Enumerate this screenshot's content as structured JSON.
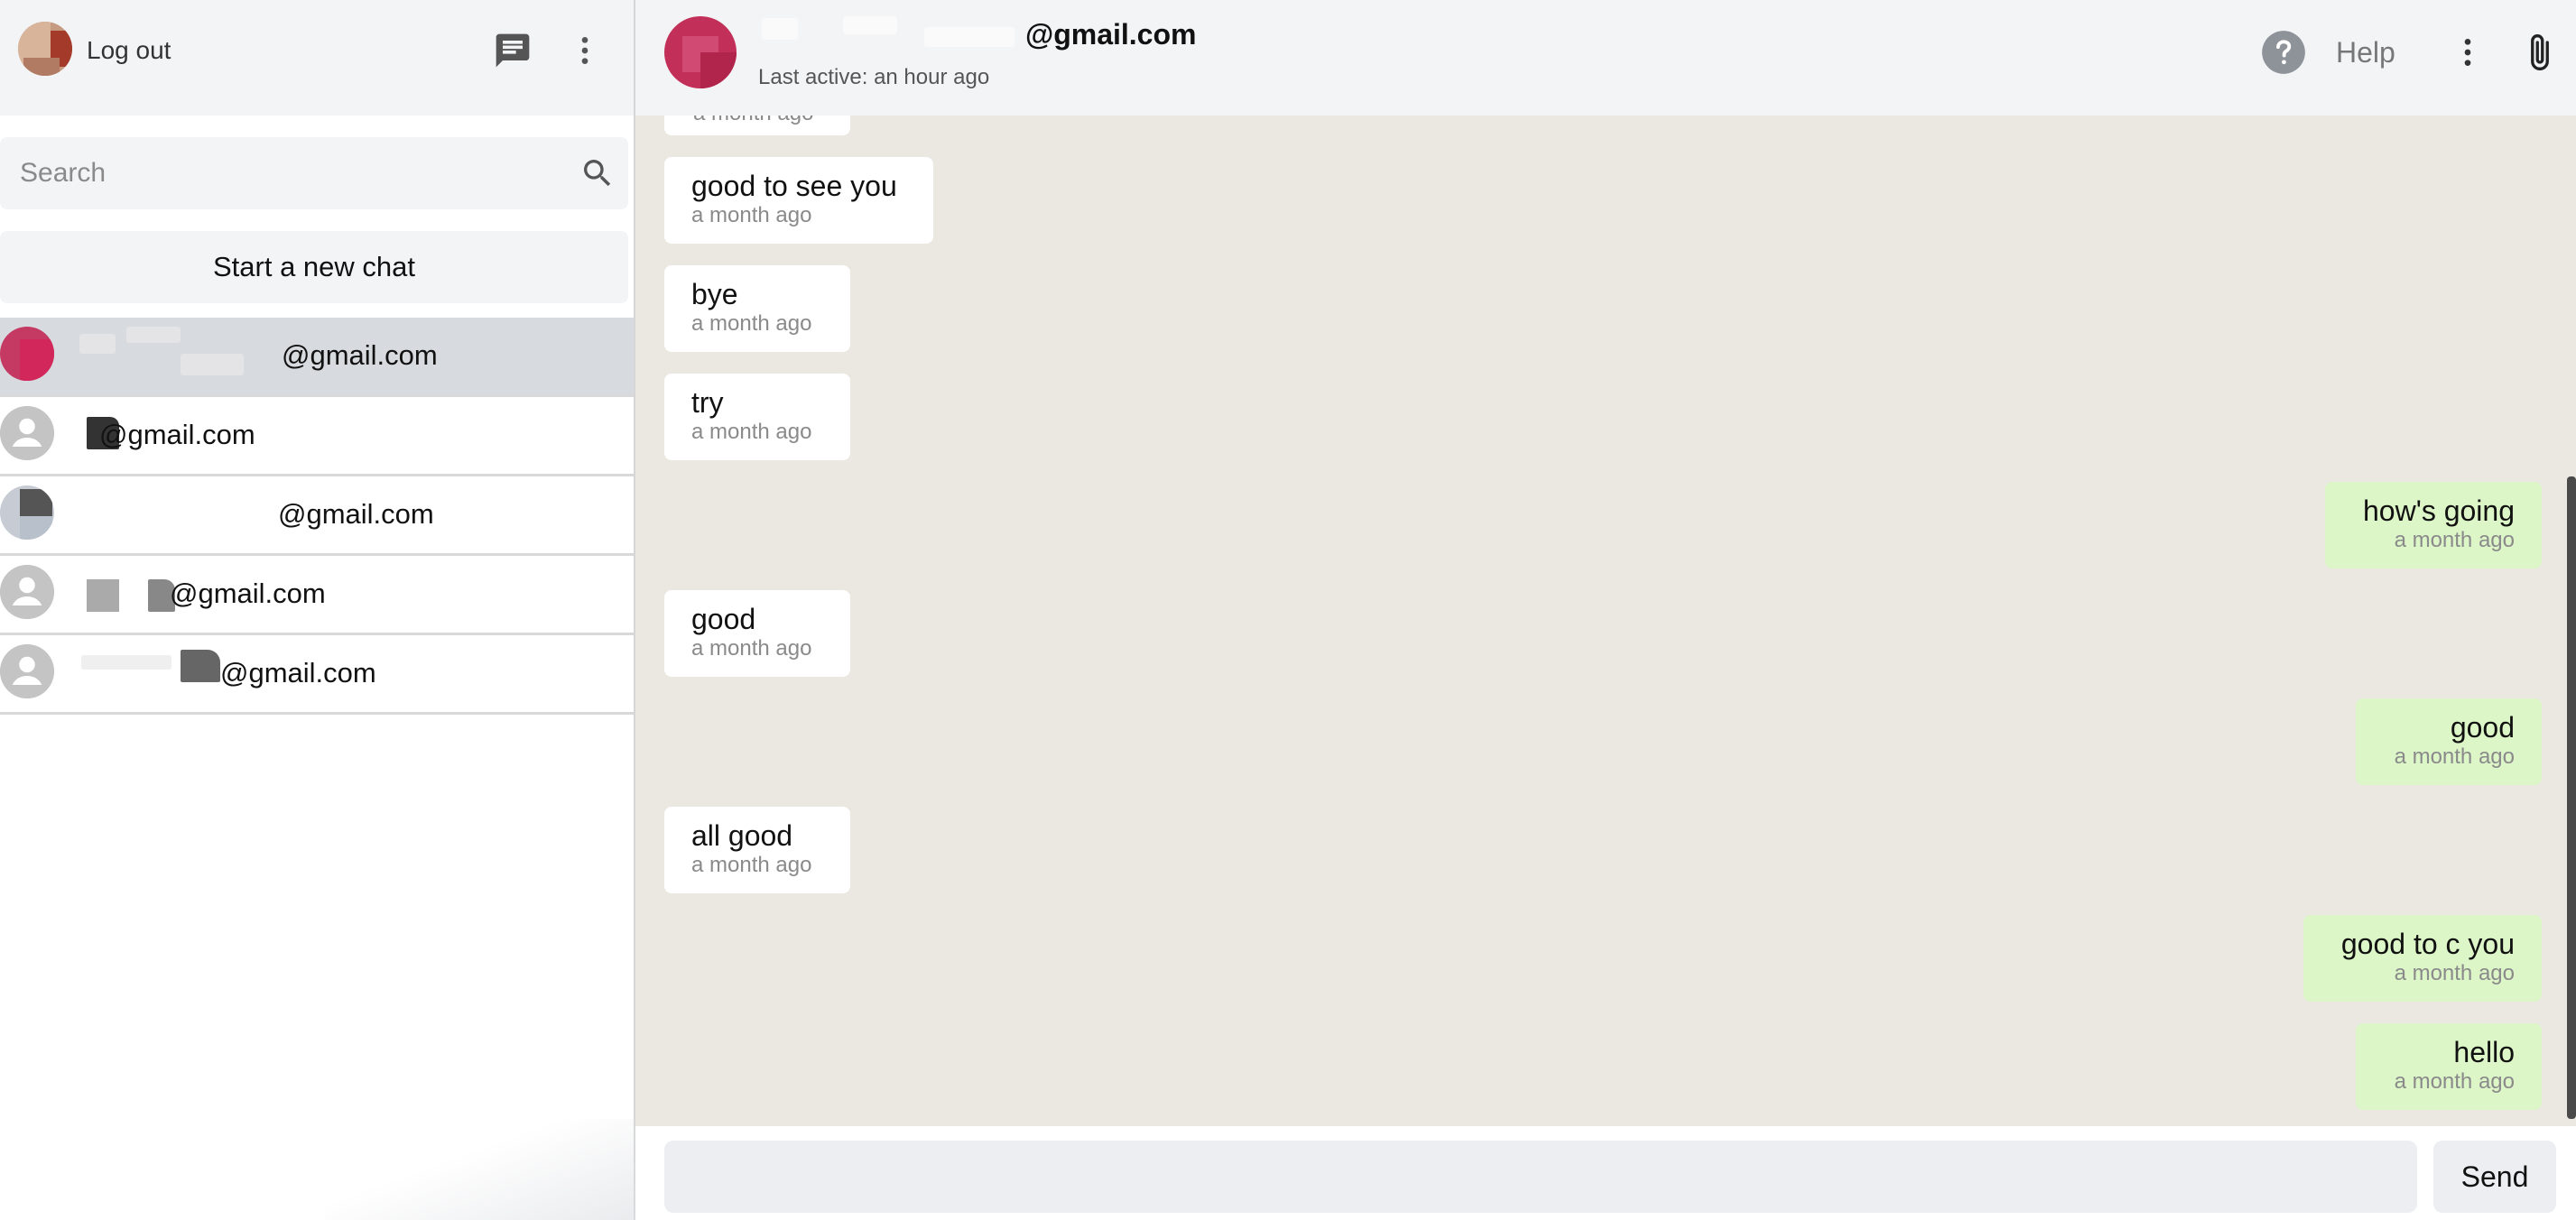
{
  "sidebar": {
    "logout_label": "Log out",
    "search_placeholder": "Search",
    "new_chat_label": "Start a new chat",
    "contacts": [
      {
        "name": "@gmail.com",
        "active": true
      },
      {
        "name": "@gmail.com",
        "active": false
      },
      {
        "name": "@gmail.com",
        "active": false
      },
      {
        "name": "@gmail.com",
        "active": false
      },
      {
        "name": "@gmail.com",
        "active": false
      }
    ]
  },
  "chat": {
    "peer_name": "@gmail.com",
    "last_active": "Last active: an hour ago",
    "help_label": "Help",
    "messages": [
      {
        "text": "",
        "time": "a month ago",
        "direction": "in"
      },
      {
        "text": "good to see you",
        "time": "a month ago",
        "direction": "in"
      },
      {
        "text": "bye",
        "time": "a month ago",
        "direction": "in"
      },
      {
        "text": "try",
        "time": "a month ago",
        "direction": "in"
      },
      {
        "text": "how's going",
        "time": "a month ago",
        "direction": "out"
      },
      {
        "text": "good",
        "time": "a month ago",
        "direction": "in"
      },
      {
        "text": "good",
        "time": "a month ago",
        "direction": "out"
      },
      {
        "text": "all good",
        "time": "a month ago",
        "direction": "in"
      },
      {
        "text": "good to c you",
        "time": "a month ago",
        "direction": "out"
      },
      {
        "text": "hello",
        "time": "a month ago",
        "direction": "out"
      }
    ],
    "composer_placeholder": "",
    "send_label": "Send"
  },
  "colors": {
    "header_bg": "#f3f4f6",
    "chat_bg": "#ebe8e1",
    "incoming_bubble": "#ffffff",
    "outgoing_bubble": "#dcf6c8",
    "active_contact": "#d7dade"
  }
}
